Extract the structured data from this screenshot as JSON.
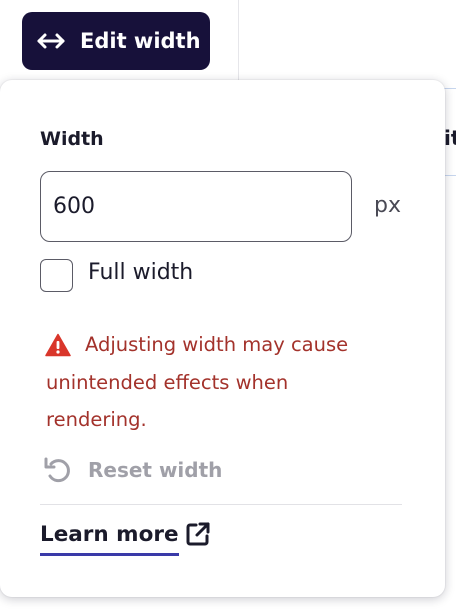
{
  "background": {
    "peek_text": "it"
  },
  "edit_button": {
    "label": "Edit width",
    "icon": "arrows-horizontal-icon"
  },
  "popover": {
    "width_label": "Width",
    "width_input": {
      "value": "600",
      "unit": "px"
    },
    "full_width": {
      "label": "Full width",
      "checked": false
    },
    "warning": {
      "icon": "warning-triangle-icon",
      "text": "Adjusting width may cause unintended effects when rendering."
    },
    "reset": {
      "label": "Reset width",
      "icon": "reset-arrow-icon",
      "enabled": false
    },
    "learn_more": {
      "label": "Learn more",
      "icon": "external-link-icon"
    }
  },
  "colors": {
    "button_bg": "#17113a",
    "warning_text": "#a3322b",
    "warning_icon": "#d9362b",
    "link_underline": "#3a3aa8",
    "disabled_text": "#a0a0a8"
  }
}
